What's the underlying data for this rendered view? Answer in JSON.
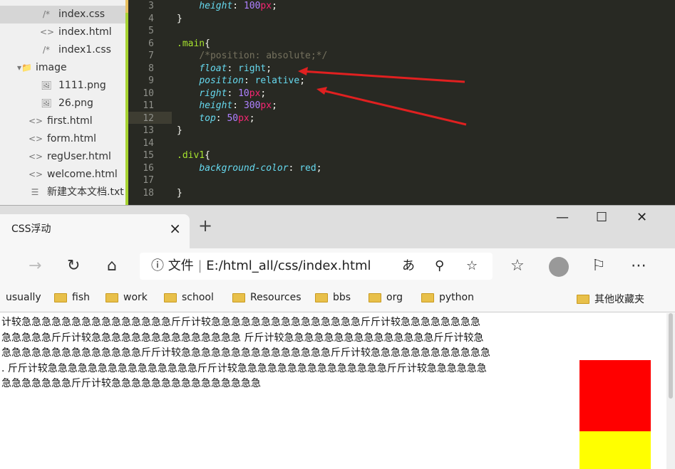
{
  "sidebar": {
    "items": [
      {
        "icon": "/*",
        "label": "index.css",
        "indent": 56,
        "selected": true
      },
      {
        "icon": "<>",
        "label": "index.html",
        "indent": 56
      },
      {
        "icon": "/*",
        "label": "index1.css",
        "indent": 56
      },
      {
        "icon": "folder",
        "label": "image",
        "indent": 24
      },
      {
        "icon": "image",
        "label": "1111.png",
        "indent": 56
      },
      {
        "icon": "image",
        "label": "26.png",
        "indent": 56
      },
      {
        "icon": "<>",
        "label": "first.html",
        "indent": 40
      },
      {
        "icon": "<>",
        "label": "form.html",
        "indent": 40
      },
      {
        "icon": "<>",
        "label": "regUser.html",
        "indent": 40
      },
      {
        "icon": "<>",
        "label": "welcome.html",
        "indent": 40
      },
      {
        "icon": "text",
        "label": "新建文本文档.txt",
        "indent": 40
      }
    ]
  },
  "editor": {
    "lines": [
      {
        "n": "3",
        "html": "    <span class='p'>height</span>: <span class='v'>100</span><span class='u'>px</span>;"
      },
      {
        "n": "4",
        "html": "}"
      },
      {
        "n": "5",
        "html": ""
      },
      {
        "n": "6",
        "html": "<span class='s'>.main</span>{"
      },
      {
        "n": "7",
        "html": "    <span class='c'>/*position: absolute;*/</span>"
      },
      {
        "n": "8",
        "html": "    <span class='p'>float</span>: <span class='k'>right</span>;"
      },
      {
        "n": "9",
        "html": "    <span class='p'>position</span>: <span class='k'>relative</span>;"
      },
      {
        "n": "10",
        "html": "    <span class='p'>right</span>: <span class='v'>10</span><span class='u'>px</span>;"
      },
      {
        "n": "11",
        "html": "    <span class='p'>height</span>: <span class='v'>300</span><span class='u'>px</span>;"
      },
      {
        "n": "12",
        "html": "    <span class='p'>top</span>: <span class='v'>50</span><span class='u'>px</span>;"
      },
      {
        "n": "13",
        "html": "}"
      },
      {
        "n": "14",
        "html": ""
      },
      {
        "n": "15",
        "html": "<span class='s'>.div1</span>{"
      },
      {
        "n": "16",
        "html": "    <span class='p'>background-color</span>: <span class='k'>red</span>;"
      },
      {
        "n": "17",
        "html": ""
      },
      {
        "n": "18",
        "html": "}"
      }
    ]
  },
  "browser": {
    "tab_title": "CSS浮动",
    "address_prefix": "文件",
    "address": "E:/html_all/css/index.html",
    "bookmarks": [
      "usually",
      "fish",
      "work",
      "school",
      "Resources",
      "bbs",
      "org",
      "python"
    ],
    "other_bookmarks": "其他收藏夹"
  },
  "page": {
    "lines": [
      "计较急急急急急急急急急急急急急急急斤斤计较急急急急急急急急急急急急急急急斤斤计较急急急急急急急急",
      "急急急急急斤斤计较急急急急急急急急急急急急急急急 斤斤计较急急急急急急急急急急急急急急急斤斤计较急",
      "急急急急急急急急急急急急急急斤斤计较急急急急急急急急急急急急急急急斤斤计较急急急急急急急急急急急急",
      ". 斤斤计较急急急急急急急急急急急急急急急斤斤计较急急急急急急急急急急急急急急急斤斤计较急急急急急急",
      "急急急急急急急斤斤计较急急急急急急急急急急急急急急急"
    ],
    "colors": {
      "box1": "#ff0000",
      "box2": "#ffff00"
    }
  }
}
